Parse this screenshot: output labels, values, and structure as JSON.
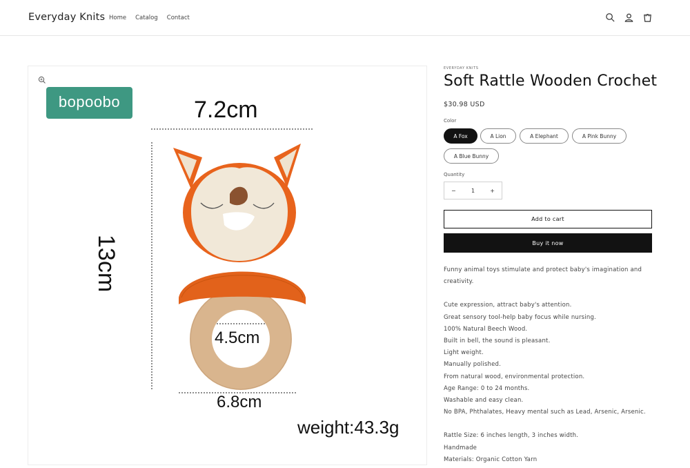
{
  "header": {
    "store_name": "Everyday Knits",
    "nav": [
      "Home",
      "Catalog",
      "Contact"
    ]
  },
  "media": {
    "brand": "bopoobo",
    "dims": {
      "width_top": "7.2cm",
      "height": "13cm",
      "inner_diameter": "4.5cm",
      "ring_width": "6.8cm",
      "weight": "weight:43.3g"
    }
  },
  "product": {
    "vendor": "EVERYDAY KNITS",
    "title": "Soft Rattle Wooden Crochet",
    "price": "$30.98 USD",
    "color_label": "Color",
    "colors": [
      "A Fox",
      "A Lion",
      "A Elephant",
      "A Pink Bunny",
      "A Blue Bunny"
    ],
    "selected_color": "A Fox",
    "quantity_label": "Quantity",
    "quantity_value": "1",
    "quantity_minus": "−",
    "quantity_plus": "+",
    "add_to_cart": "Add to cart",
    "buy_now": "Buy it now",
    "description": {
      "intro": "Funny animal toys stimulate and protect baby's imagination and creativity.",
      "features": [
        "Cute expression, attract baby's attention.",
        "Great sensory tool-help baby focus while nursing.",
        "100% Natural Beech Wood.",
        "Built in bell, the sound is pleasant.",
        "Light weight.",
        "Manually polished.",
        "From natural wood, environmental protection.",
        "Age Range: 0 to 24 months.",
        "Washable and easy clean.",
        "No BPA, Phthalates, Heavy mental such as Lead, Arsenic, Arsenic."
      ],
      "specs": [
        "Rattle Size: 6 inches length, 3 inches width.",
        "Handmade",
        "Materials: Organic Cotton Yarn"
      ]
    }
  },
  "colors": {
    "accent": "#121212",
    "brand_teal": "#3e9882",
    "fox_orange": "#e2621b",
    "cream": "#f1e8d8",
    "wood": "#d9b58e"
  },
  "icons": [
    "search-icon",
    "account-icon",
    "cart-icon",
    "zoom-icon"
  ]
}
